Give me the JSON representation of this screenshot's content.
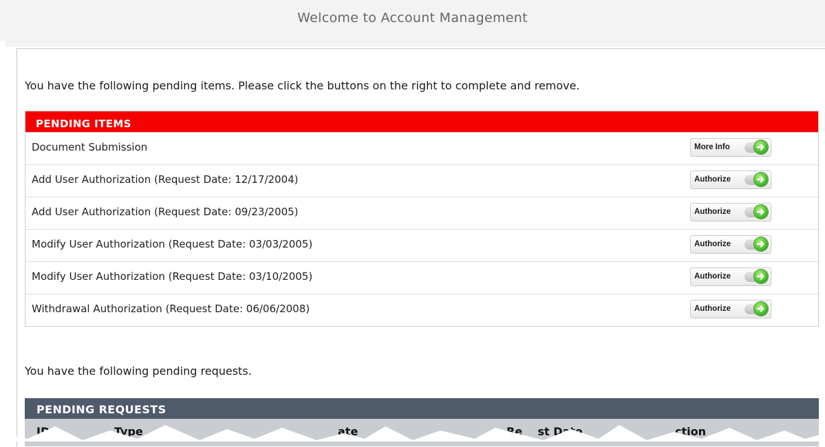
{
  "page": {
    "title": "Welcome to Account Management",
    "intro": "You have the following pending items. Please click the buttons on the right to complete and remove."
  },
  "pending_items": {
    "header": "PENDING ITEMS",
    "rows": [
      {
        "label": "Document Submission",
        "button": "More Info"
      },
      {
        "label": "Add User Authorization (Request Date: 12/17/2004)",
        "button": "Authorize"
      },
      {
        "label": "Add User Authorization (Request Date: 09/23/2005)",
        "button": "Authorize"
      },
      {
        "label": "Modify User Authorization (Request Date: 03/03/2005)",
        "button": "Authorize"
      },
      {
        "label": "Modify User Authorization (Request Date: 03/10/2005)",
        "button": "Authorize"
      },
      {
        "label": "Withdrawal Authorization (Request Date: 06/06/2008)",
        "button": "Authorize"
      }
    ]
  },
  "pending_requests": {
    "intro": "You have the following pending requests.",
    "header": "PENDING REQUESTS",
    "columns": [
      "ID",
      "Type",
      "ate",
      "Re    st Date",
      "ction"
    ]
  },
  "colors": {
    "items_header": "#f40000",
    "requests_header": "#4f5a6b",
    "go_icon": "#3fb52b"
  },
  "icons": {
    "button_indicator": "green-arrow-toggle-icon"
  }
}
